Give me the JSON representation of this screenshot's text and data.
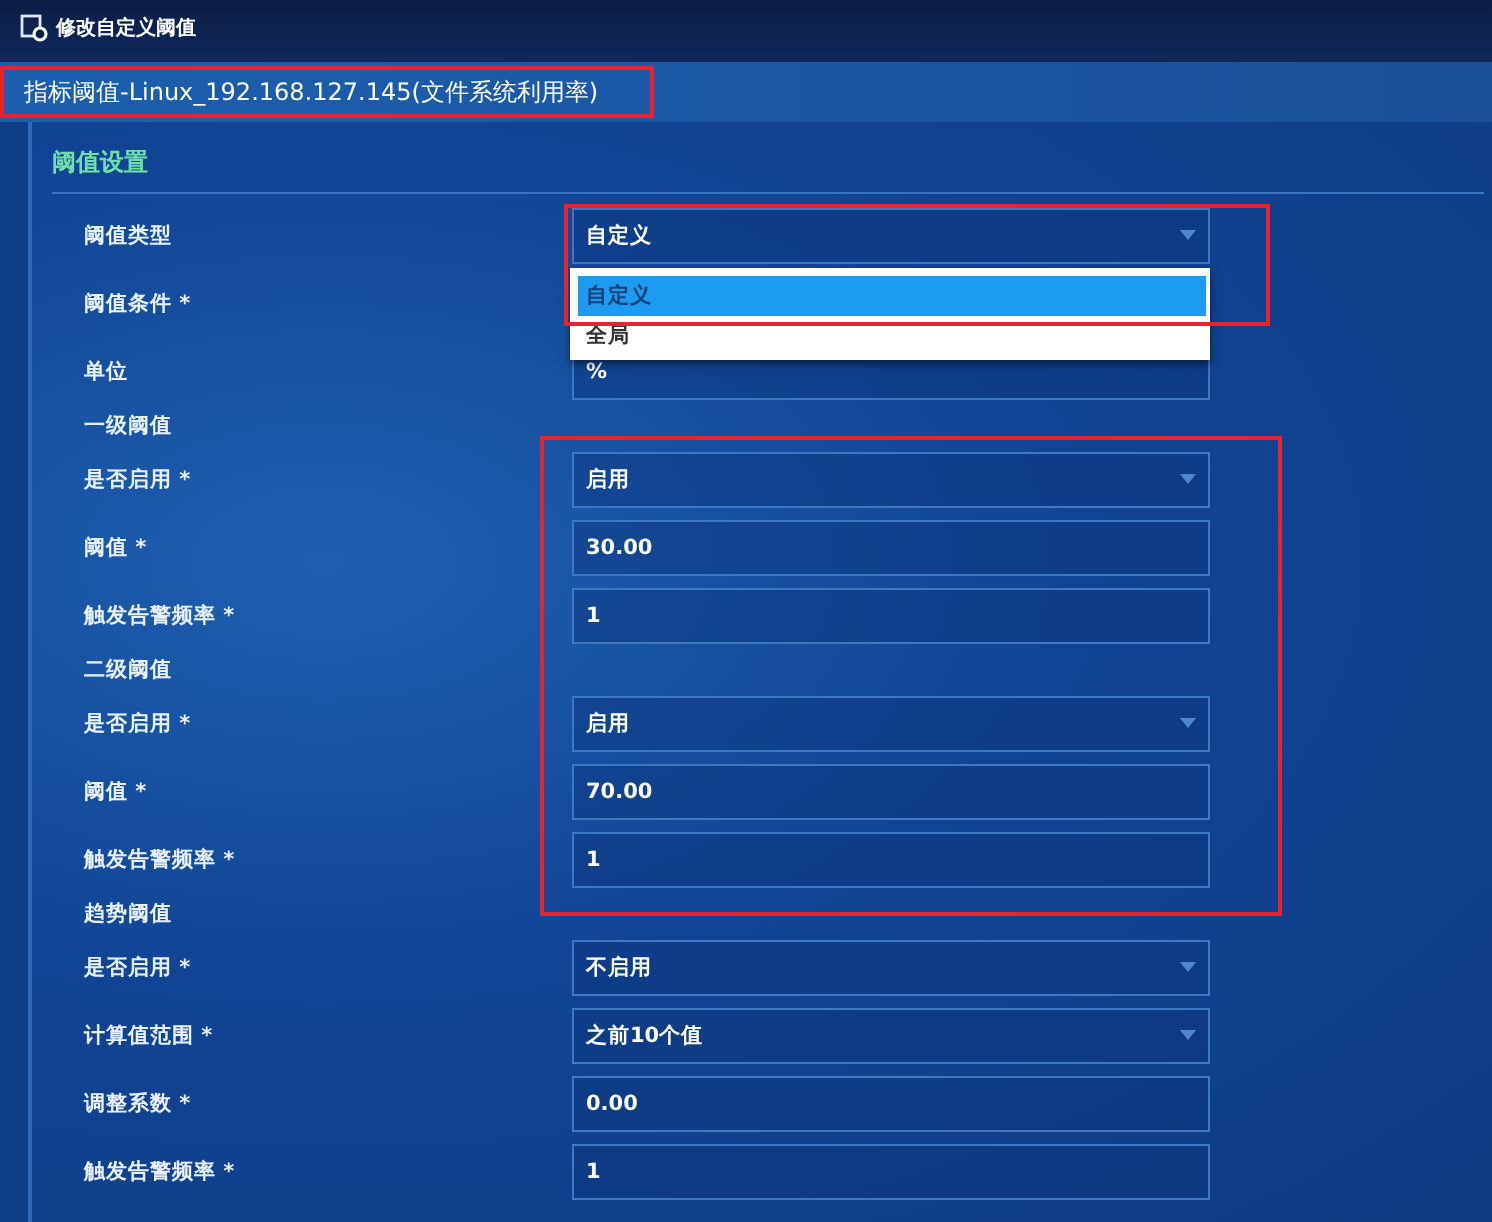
{
  "window": {
    "title": "修改自定义阈值"
  },
  "header": {
    "text": "指标阈值-Linux_192.168.127.145(文件系统利用率)",
    "highlighted": true
  },
  "section": {
    "title": "阈值设置"
  },
  "rows": [
    {
      "kind": "select",
      "label": "阈值类型",
      "value": "自定义",
      "highlighted": true,
      "open": true,
      "options": [
        {
          "label": "自定义",
          "selected": true
        },
        {
          "label": "全局",
          "selected": false
        }
      ]
    },
    {
      "kind": "label",
      "label": "阈值条件 *"
    },
    {
      "kind": "input",
      "label": "单位",
      "value": "%",
      "highlighted": false
    },
    {
      "kind": "group",
      "label": "一级阈值"
    },
    {
      "kind": "select",
      "label": "是否启用 *",
      "value": "启用",
      "highlighted": true
    },
    {
      "kind": "input",
      "label": "阈值 *",
      "value": "30.00",
      "highlighted": true
    },
    {
      "kind": "input",
      "label": "触发告警频率 *",
      "value": "1",
      "highlighted": true
    },
    {
      "kind": "group",
      "label": "二级阈值"
    },
    {
      "kind": "select",
      "label": "是否启用 *",
      "value": "启用",
      "highlighted": true
    },
    {
      "kind": "input",
      "label": "阈值 *",
      "value": "70.00",
      "highlighted": true
    },
    {
      "kind": "input",
      "label": "触发告警频率 *",
      "value": "1",
      "highlighted": true
    },
    {
      "kind": "group",
      "label": "趋势阈值"
    },
    {
      "kind": "select",
      "label": "是否启用 *",
      "value": "不启用",
      "highlighted": false
    },
    {
      "kind": "select",
      "label": "计算值范围 *",
      "value": "之前10个值",
      "highlighted": false
    },
    {
      "kind": "input",
      "label": "调整系数 *",
      "value": "0.00",
      "highlighted": false
    },
    {
      "kind": "input",
      "label": "触发告警频率 *",
      "value": "1",
      "highlighted": false
    }
  ]
}
